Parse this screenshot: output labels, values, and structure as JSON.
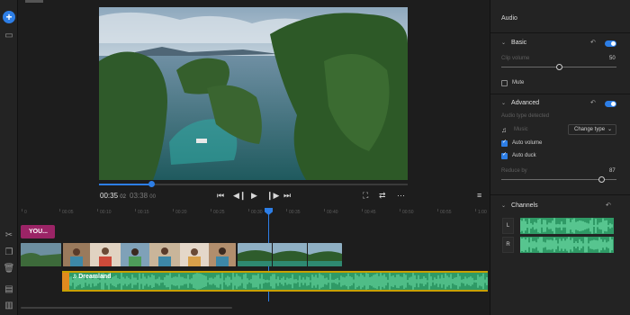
{
  "toolbar_left": {
    "icons": [
      "plus-icon",
      "library-icon",
      "scissors-icon",
      "duplicate-icon",
      "trash-icon",
      "split-icon",
      "align-icon"
    ]
  },
  "player": {
    "current_time": "00:35",
    "current_frame": "02",
    "duration": "03:38",
    "duration_frame": "00",
    "progress": 0.17
  },
  "ruler": {
    "labels": [
      "0",
      "00:05",
      "00:10",
      "00:15",
      "00:20",
      "00:25",
      "00:30",
      "00:35",
      "00:40",
      "00:45",
      "00:50",
      "00:55",
      "1:00"
    ]
  },
  "timeline": {
    "title_clip": "YOU...",
    "audio_clip": "Dreamland"
  },
  "audio_panel": {
    "title": "Audio",
    "basic": {
      "label": "Basic",
      "clip_volume_label": "Clip volume",
      "clip_volume_value": "50",
      "mute_label": "Mute"
    },
    "advanced": {
      "label": "Advanced",
      "audio_type_label": "Audio type detected",
      "type_name": "Music",
      "change_type_label": "Change type",
      "auto_volume_label": "Auto volume",
      "auto_duck_label": "Auto duck",
      "reduce_by_label": "Reduce by",
      "reduce_by_value": "87"
    },
    "channels": {
      "label": "Channels",
      "left": "L",
      "right": "R"
    }
  },
  "colors": {
    "accent": "#2d7ee6",
    "title_clip": "#9b2466",
    "audio_wave": "#2f9a66",
    "audio_border": "#c8a000"
  }
}
